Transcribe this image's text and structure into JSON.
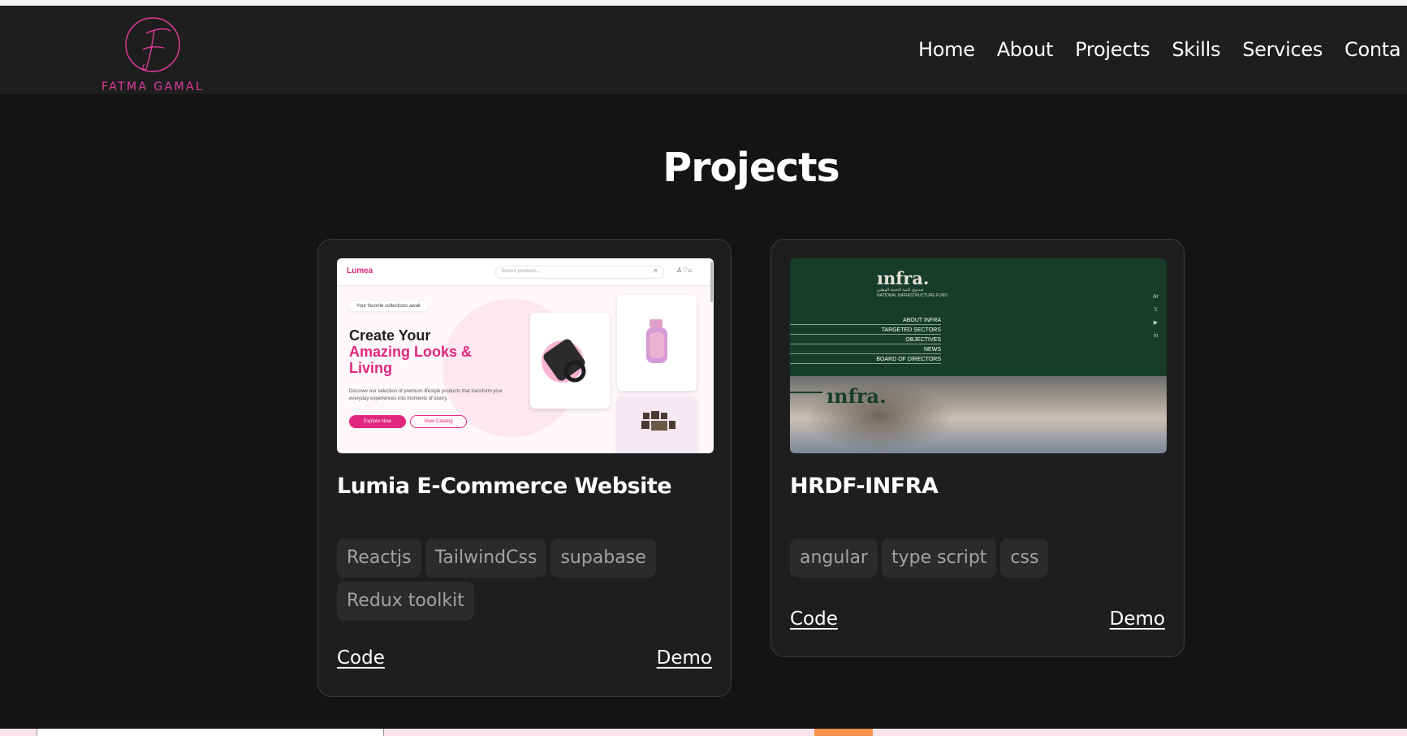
{
  "logo": {
    "monogram": "F",
    "text": "FATMA GAMAL",
    "color": "#e0399d"
  },
  "nav": {
    "items": [
      "Home",
      "About",
      "Projects",
      "Skills",
      "Services",
      "Conta"
    ]
  },
  "section": {
    "title": "Projects"
  },
  "projects": [
    {
      "title": "Lumia E-Commerce Website",
      "tags": [
        "Reactjs",
        "TailwindCss",
        "supabase",
        "Redux toolkit"
      ],
      "code_label": "Code",
      "demo_label": "Demo",
      "preview": {
        "logo": "Lumea",
        "search_placeholder": "Search products...",
        "pill": "Your favorite collections await",
        "headline_1": "Create Your",
        "headline_2": "Amazing Looks &",
        "headline_3": "Living",
        "description": "Discover our selection of premium lifestyle products that transform your everyday experiences into moments of luxury.",
        "button_primary": "Explore Now",
        "button_secondary": "View Catalog"
      }
    },
    {
      "title": "HRDF-INFRA",
      "tags": [
        "angular",
        "type script",
        "css"
      ],
      "code_label": "Code",
      "demo_label": "Demo",
      "preview": {
        "logo": "ınfra.",
        "arabic": "صندوق البنية التحتية الوطني",
        "subtitle": "NATIONAL INFRASTRUCTURE FUND",
        "menu": [
          "ABOUT INFRA",
          "TARGETED SECTORS",
          "OBJECTIVES",
          "NEWS",
          "BOARD OF DIRECTORS"
        ],
        "social": [
          "Ar",
          "𝕏",
          "▶",
          "in"
        ],
        "logo_bottom": "ınfra."
      }
    }
  ],
  "colors": {
    "background": "#141414",
    "navbar": "#1e1e1e",
    "card": "#1e1e1e",
    "tag_bg": "#2b2b2b",
    "accent": "#e0267f"
  }
}
